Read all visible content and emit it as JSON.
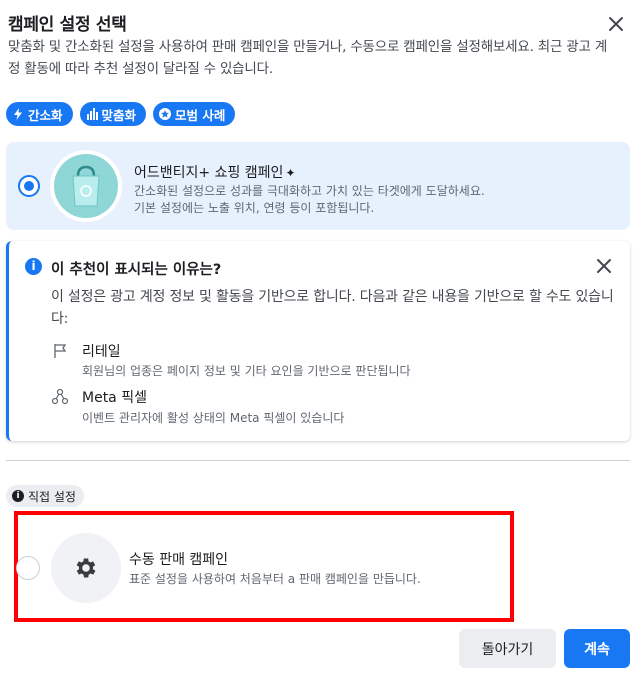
{
  "header": {
    "title": "캠페인 설정 선택",
    "description": "맞춤화 및 간소화된 설정을 사용하여 판매 캠페인을 만들거나, 수동으로 캠페인을 설정해보세요. 최근 광고 계정 활동에 따라 추천 설정이 달라질 수 있습니다."
  },
  "chips": [
    {
      "label": "간소화",
      "icon": "bolt-icon"
    },
    {
      "label": "맞춤화",
      "icon": "bar-chart-icon"
    },
    {
      "label": "모범 사례",
      "icon": "star-icon"
    }
  ],
  "recommended": {
    "title": "어드밴티지+ 쇼핑 캠페인",
    "subtitle_1": "간소화된 설정으로 성과를 극대화하고 가치 있는 타겟에게 도달하세요.",
    "subtitle_2": "기본 설정에는 노출 위치, 연령 등이 포함됩니다.",
    "selected": true,
    "icon": "shopping-bag-icon"
  },
  "info": {
    "title": "이 추천이 표시되는 이유는?",
    "body": "이 설정은 광고 계정 정보 및 활동을 기반으로 합니다. 다음과 같은 내용을 기반으로 할 수도 있습니다:",
    "reasons": [
      {
        "title": "리테일",
        "subtitle": "회원님의 업종은 페이지 정보 및 기타 요인을 기반으로 판단됩니다",
        "icon": "flag-icon"
      },
      {
        "title": "Meta 픽셀",
        "subtitle": "이벤트 관리자에 활성 상태의 Meta 픽셀이 있습니다",
        "icon": "pixel-icon"
      }
    ]
  },
  "manual": {
    "badge": "직접 설정",
    "title": "수동 판매 캠페인",
    "subtitle": "표준 설정을 사용하여 처음부터 a 판매 캠페인을 만듭니다.",
    "selected": false,
    "icon": "gear-icon"
  },
  "footer": {
    "back_label": "돌아가기",
    "next_label": "계속"
  },
  "colors": {
    "accent": "#1877f2",
    "highlight": "#ff0000",
    "card_bg": "#e7f0fd"
  }
}
